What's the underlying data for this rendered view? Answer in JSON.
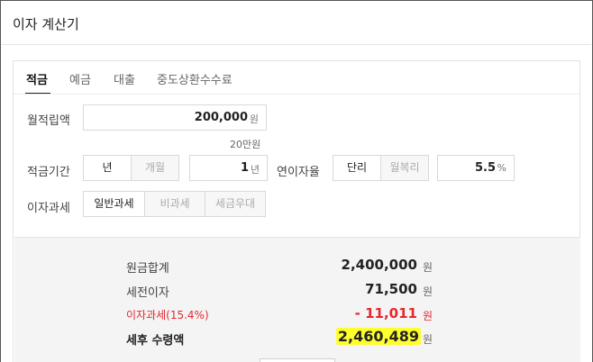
{
  "app": {
    "title": "이자 계산기"
  },
  "tabs": [
    {
      "label": "적금",
      "active": true
    },
    {
      "label": "예금",
      "active": false
    },
    {
      "label": "대출",
      "active": false
    },
    {
      "label": "중도상환수수료",
      "active": false
    }
  ],
  "form": {
    "monthly": {
      "label": "월적립액",
      "value": "200,000",
      "unit": "원",
      "hint": "20만원"
    },
    "period": {
      "label": "적금기간",
      "options": [
        "년",
        "개월"
      ],
      "selected": "년",
      "value": "1",
      "unit": "년"
    },
    "rate": {
      "label": "연이자율",
      "options": [
        "단리",
        "월복리"
      ],
      "selected": "단리",
      "value": "5.5",
      "unit": "%"
    },
    "tax": {
      "label": "이자과세",
      "options": [
        "일반과세",
        "비과세",
        "세금우대"
      ],
      "selected": "일반과세"
    }
  },
  "results": [
    {
      "label": "원금합계",
      "value": "2,400,000",
      "unit": "원"
    },
    {
      "label": "세전이자",
      "value": "71,500",
      "unit": "원"
    },
    {
      "label": "이자과세(15.4%)",
      "value": "- 11,011",
      "unit": "원",
      "color": "#e5282d"
    },
    {
      "label": "세후 수령액",
      "value": "2,460,489",
      "unit": "원",
      "highlight_color": "#ffff2e"
    }
  ]
}
